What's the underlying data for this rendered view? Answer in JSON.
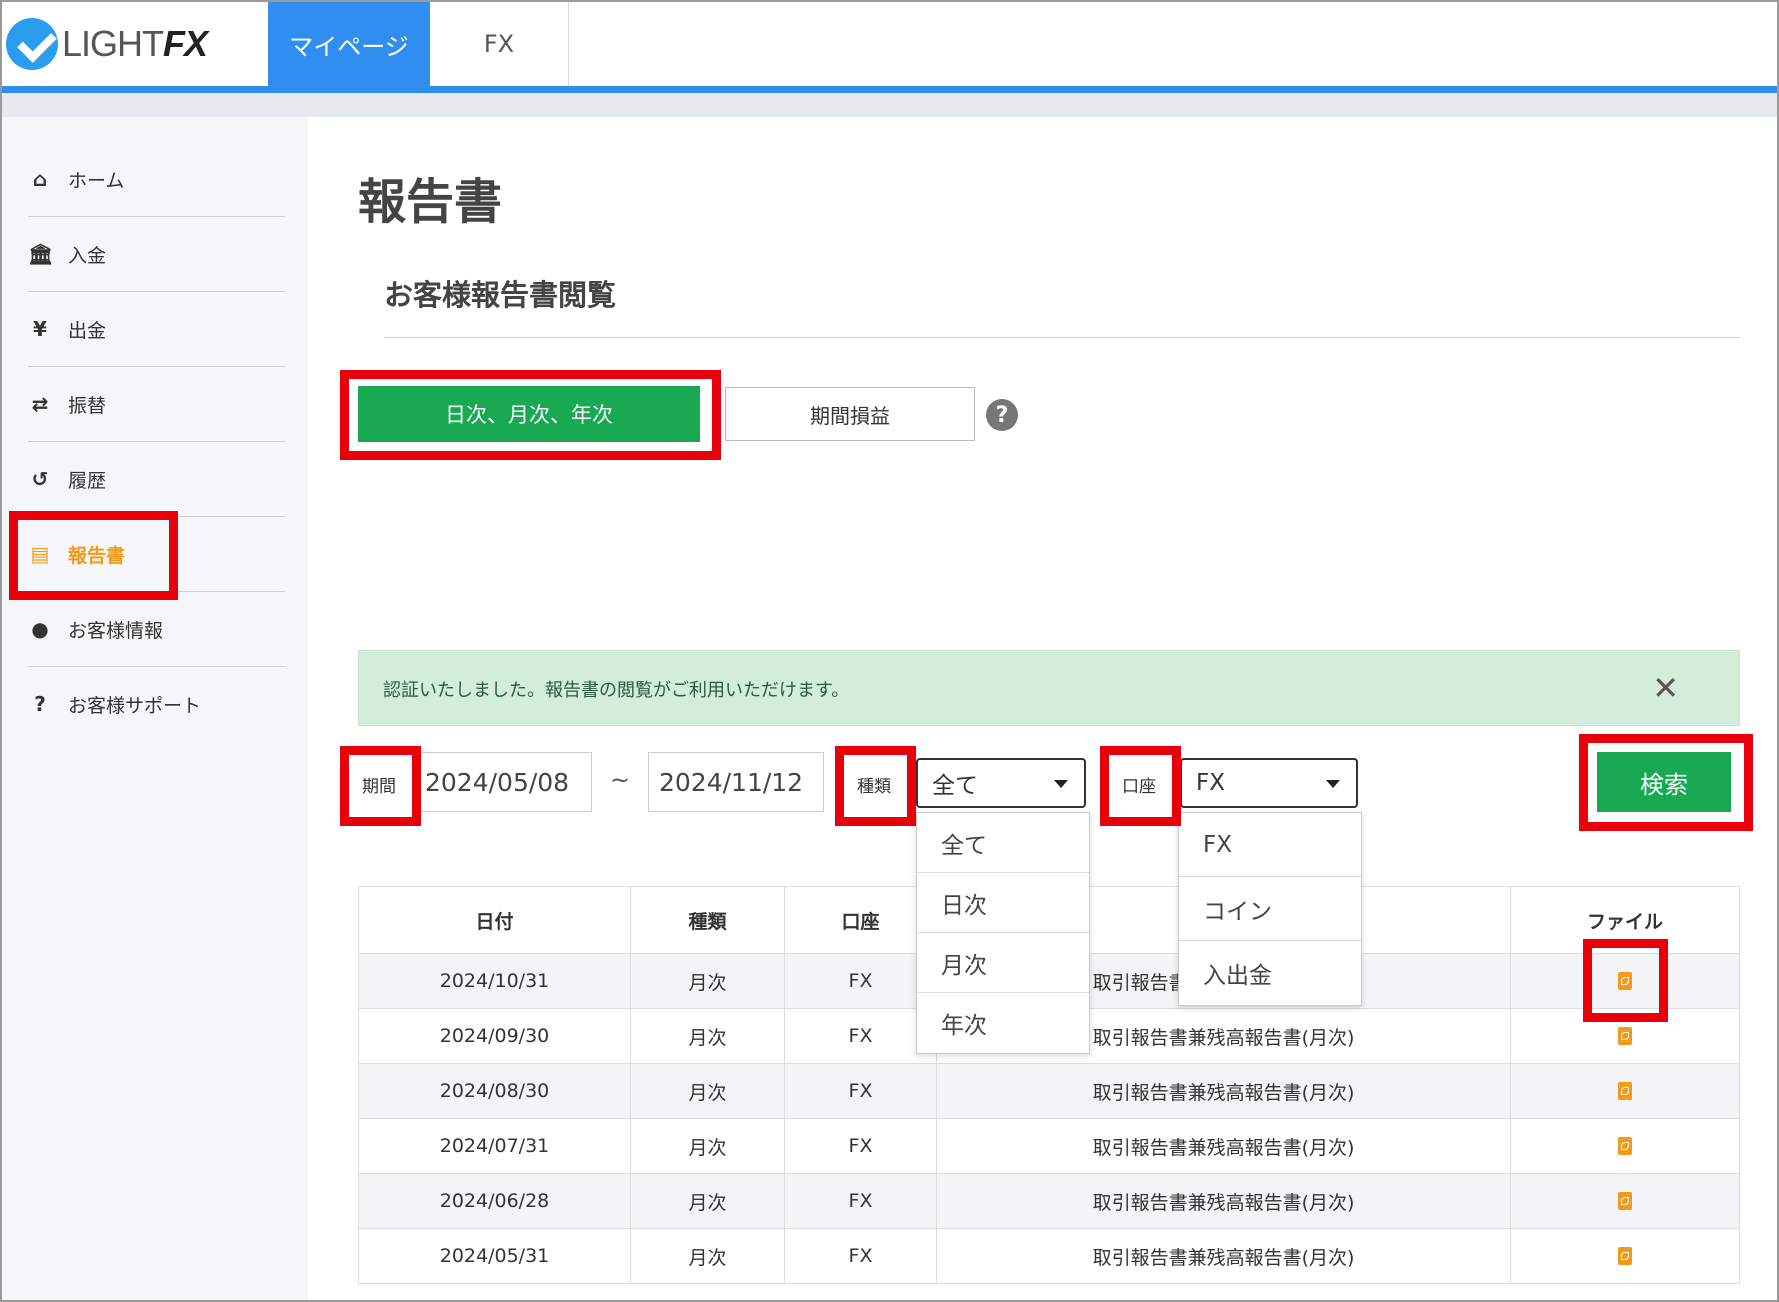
{
  "header": {
    "logo_text_light": "LIGHT",
    "logo_text_fx": "FX",
    "tabs": [
      {
        "label": "マイページ"
      },
      {
        "label": "FX"
      }
    ]
  },
  "sidebar": {
    "items": [
      {
        "icon": "home-icon",
        "glyph": "⌂",
        "label": "ホーム"
      },
      {
        "icon": "bank-icon",
        "glyph": "🏛",
        "label": "入金"
      },
      {
        "icon": "yen-icon",
        "glyph": "¥",
        "label": "出金"
      },
      {
        "icon": "transfer-icon",
        "glyph": "⇄",
        "label": "振替"
      },
      {
        "icon": "history-icon",
        "glyph": "↺",
        "label": "履歴"
      },
      {
        "icon": "document-icon",
        "glyph": "▤",
        "label": "報告書"
      },
      {
        "icon": "user-icon",
        "glyph": "●",
        "label": "お客様情報"
      },
      {
        "icon": "question-icon",
        "glyph": "?",
        "label": "お客様サポート"
      }
    ]
  },
  "main": {
    "page_title": "報告書",
    "section_title": "お客様報告書閲覧",
    "periodic_button": "日次、月次、年次",
    "range_button": "期間損益",
    "help_glyph": "?",
    "alert_text": "認証いたしました。報告書の閲覧がご利用いただけます。",
    "alert_close": "✕"
  },
  "filters": {
    "period_label": "期間",
    "date_from": "2024/05/08",
    "tilde": "~",
    "date_to": "2024/11/12",
    "type_label": "種類",
    "type_selected": "全て",
    "account_label": "口座",
    "account_selected": "FX",
    "search_button": "検索",
    "type_options": [
      "全て",
      "日次",
      "月次",
      "年次"
    ],
    "account_options": [
      "FX",
      "コイン",
      "入出金"
    ]
  },
  "table": {
    "headers": [
      "日付",
      "種類",
      "口座",
      "",
      "ファイル"
    ],
    "rows": [
      [
        "2024/10/31",
        "月次",
        "FX",
        "取引報告書兼残高報告書(月次)"
      ],
      [
        "2024/09/30",
        "月次",
        "FX",
        "取引報告書兼残高報告書(月次)"
      ],
      [
        "2024/08/30",
        "月次",
        "FX",
        "取引報告書兼残高報告書(月次)"
      ],
      [
        "2024/07/31",
        "月次",
        "FX",
        "取引報告書兼残高報告書(月次)"
      ],
      [
        "2024/06/28",
        "月次",
        "FX",
        "取引報告書兼残高報告書(月次)"
      ],
      [
        "2024/05/31",
        "月次",
        "FX",
        "取引報告書兼残高報告書(月次)"
      ]
    ]
  },
  "colors": {
    "accent_blue": "#2f8ef0",
    "green": "#1aa953",
    "active_orange": "#f29a1b",
    "highlight_red": "#e8000b"
  }
}
